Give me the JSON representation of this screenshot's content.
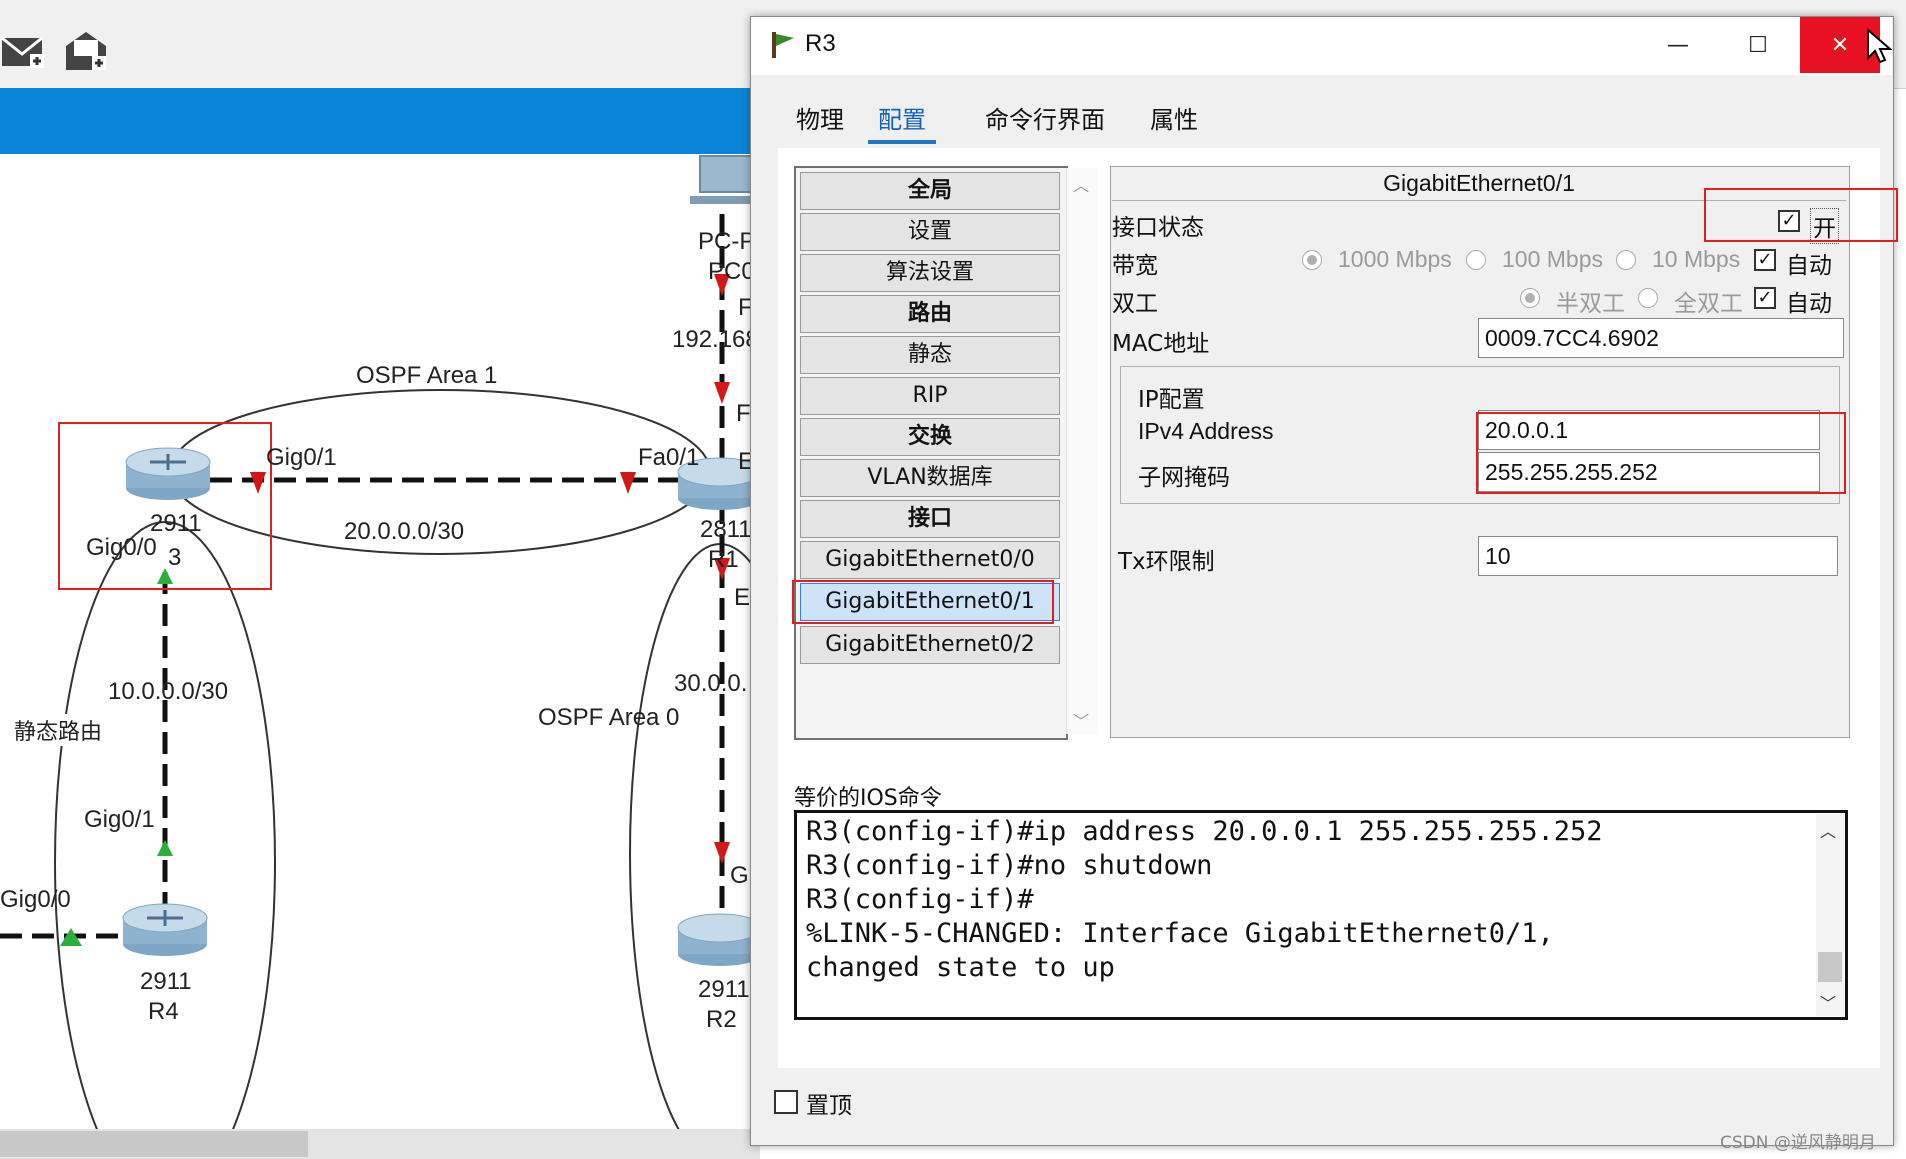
{
  "window": {
    "title": "R3",
    "minimize_icon": "minimize-icon",
    "maximize_icon": "maximize-icon",
    "close_icon": "close-icon",
    "close_color": "#e81123"
  },
  "tabs": [
    {
      "label": "物理",
      "active": false
    },
    {
      "label": "配置",
      "active": true
    },
    {
      "label": "命令行界面",
      "active": false
    },
    {
      "label": "属性",
      "active": false
    }
  ],
  "left_list": {
    "items": [
      {
        "label": "全局",
        "bold": true
      },
      {
        "label": "设置",
        "bold": false
      },
      {
        "label": "算法设置",
        "bold": false
      },
      {
        "label": "路由",
        "bold": true
      },
      {
        "label": "静态",
        "bold": false
      },
      {
        "label": "RIP",
        "bold": false
      },
      {
        "label": "交换",
        "bold": true
      },
      {
        "label": "VLAN数据库",
        "bold": false
      },
      {
        "label": "接口",
        "bold": true
      },
      {
        "label": "GigabitEthernet0/0",
        "bold": false
      },
      {
        "label": "GigabitEthernet0/1",
        "bold": false,
        "selected": true
      },
      {
        "label": "GigabitEthernet0/2",
        "bold": false
      }
    ]
  },
  "interface_panel": {
    "title": "GigabitEthernet0/1",
    "port_status": {
      "label": "接口状态",
      "checkbox_label": "开",
      "checked": true
    },
    "bandwidth": {
      "label": "带宽",
      "options": [
        "1000 Mbps",
        "100 Mbps",
        "10 Mbps"
      ],
      "auto_label": "自动",
      "auto_checked": true
    },
    "duplex": {
      "label": "双工",
      "options": [
        "半双工",
        "全双工"
      ],
      "auto_label": "自动",
      "auto_checked": true
    },
    "mac": {
      "label": "MAC地址",
      "value": "0009.7CC4.6902"
    },
    "ip_config": {
      "group_label": "IP配置",
      "ipv4_label": "IPv4 Address",
      "ipv4_value": "20.0.0.1",
      "mask_label": "子网掩码",
      "mask_value": "255.255.255.252"
    },
    "tx_ring": {
      "label": "Tx环限制",
      "value": "10"
    }
  },
  "ios": {
    "label": "等价的IOS命令",
    "lines": [
      "R3(config-if)#ip address 20.0.0.1 255.255.255.252",
      "R3(config-if)#no shutdown",
      "R3(config-if)#",
      "%LINK-5-CHANGED: Interface GigabitEthernet0/1,",
      "changed state to up"
    ]
  },
  "pin_on_top": {
    "label": "置顶",
    "checked": false
  },
  "topology": {
    "labels": {
      "ospf_area1": "OSPF Area 1",
      "ospf_area0": "OSPF Area 0",
      "static_route": "静态路由",
      "net_20": "20.0.0.0/30",
      "net_10": "10.0.0.0/30",
      "net_30": "30.0.0.",
      "net_192": "192.168",
      "r3_gig01": "Gig0/1",
      "r3_gig00": "Gig0/0",
      "r3_model": "2911",
      "r3_name": "3",
      "r1_fa01": "Fa0/1",
      "r1_model": "2811",
      "r1_name": "R1",
      "r4_gig01": "Gig0/1",
      "r4_gig00": "Gig0/0",
      "r4_model": "2911",
      "r4_name": "R4",
      "r2_model": "2911",
      "r2_name": "R2",
      "pc_a": "PC-P",
      "pc_b": "PC0",
      "frag_f": "F",
      "frag_fa": "F",
      "frag_e": "E",
      "frag_et": "Et",
      "frag_gi": "Gi"
    }
  },
  "watermark": "CSDN @逆风静明月"
}
